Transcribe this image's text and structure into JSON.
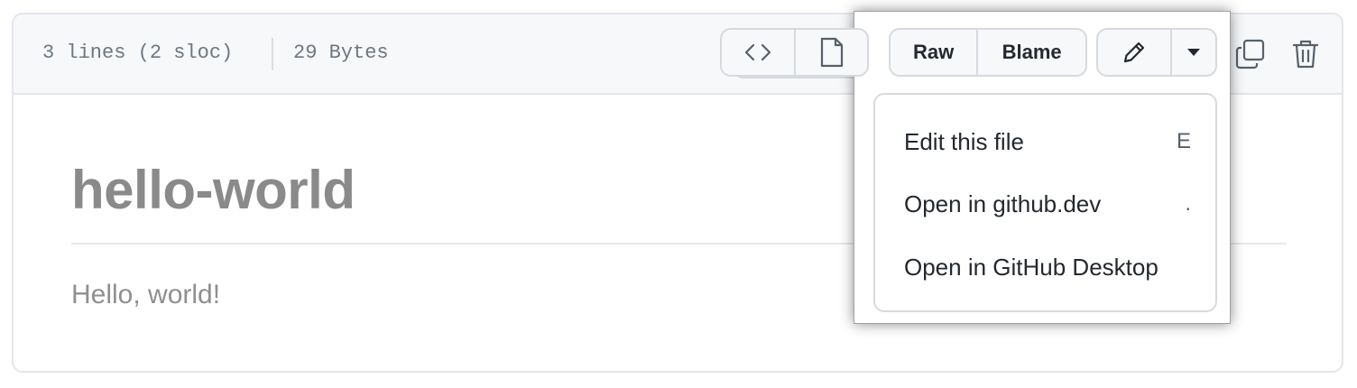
{
  "header": {
    "lines_info": "3 lines (2 sloc)",
    "size_info": "29 Bytes"
  },
  "toolbar": {
    "view_toggle": [
      {
        "icon": "code-icon"
      },
      {
        "icon": "file-icon"
      }
    ],
    "raw_label": "Raw",
    "blame_label": "Blame",
    "edit_icon": "pencil-icon",
    "dropdown_icon": "triangle-down-icon",
    "copy_icon": "copy-icon",
    "delete_icon": "trash-icon"
  },
  "readme": {
    "title": "hello-world",
    "body": "Hello, world!"
  },
  "edit_menu": {
    "items": [
      {
        "label": "Edit this file",
        "shortcut": "E"
      },
      {
        "label": "Open in github.dev",
        "shortcut": "."
      },
      {
        "label": "Open in GitHub Desktop",
        "shortcut": ""
      }
    ]
  },
  "colors": {
    "header_bg": "#f6f8fa",
    "border": "#d6dade",
    "muted_text": "#6e7781"
  }
}
